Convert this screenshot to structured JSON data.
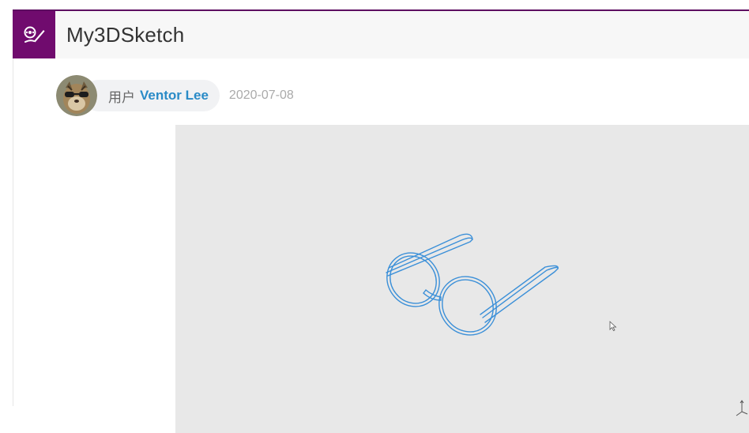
{
  "header": {
    "app_title": "My3DSketch",
    "logo_icon": "sketch-logo-icon",
    "accent_color": "#700b6e"
  },
  "post": {
    "user_prefix": "用户",
    "user_name": "Ventor Lee",
    "date": "2020-07-08"
  },
  "viewer": {
    "model": "glasses-wireframe",
    "background_color": "#e8e8e8",
    "line_color": "#3a8fd8"
  }
}
